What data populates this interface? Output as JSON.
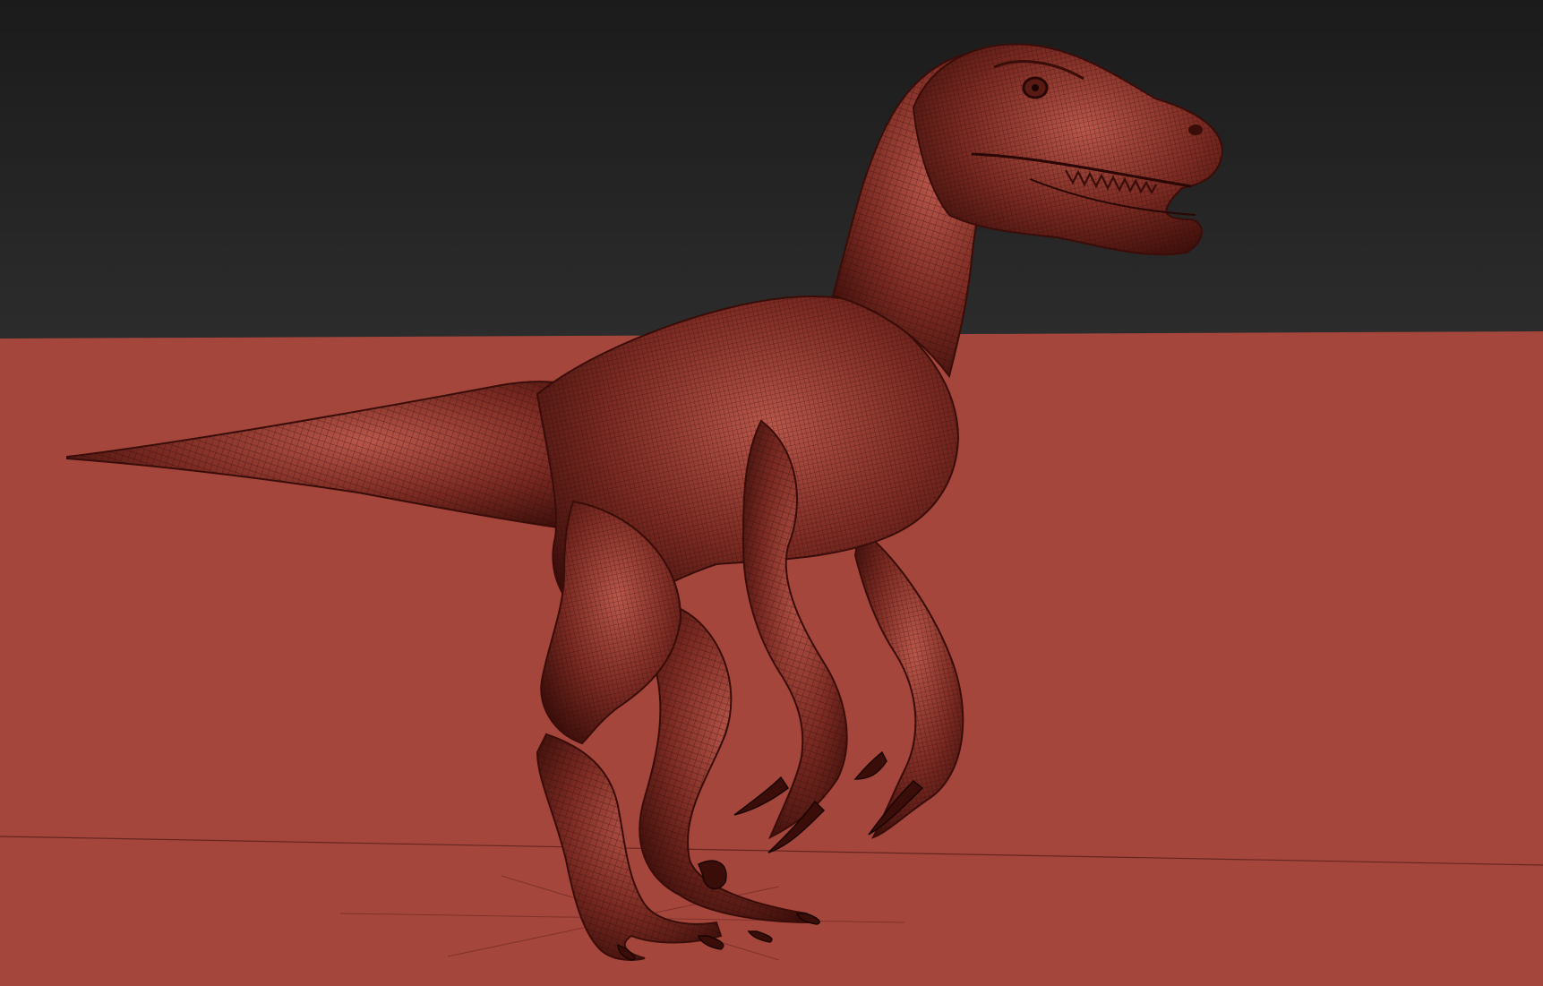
{
  "scene": {
    "subject_icon": "raptor-wireframe-icon",
    "colors": {
      "sky_top": "#1b1b1b",
      "sky_bottom": "#2c2c2c",
      "ground": "#a4463c",
      "model_base": "#7a2a22",
      "model_dark": "#3a0d09",
      "model_light": "#b8564a",
      "wire": "#2a0a07"
    }
  }
}
